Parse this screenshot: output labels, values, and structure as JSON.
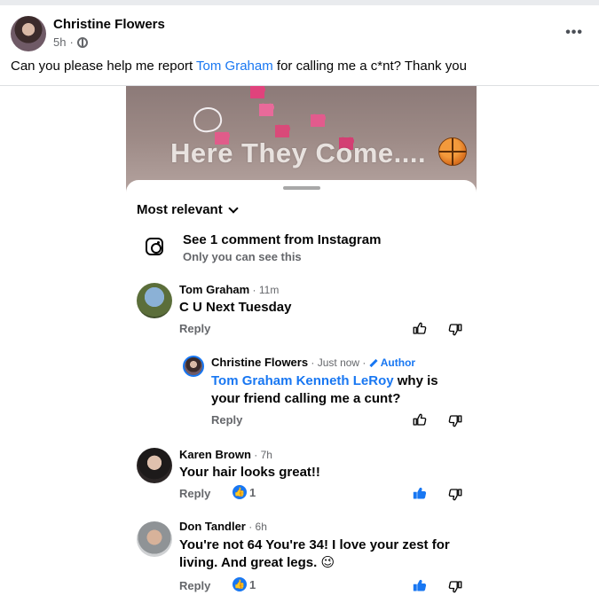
{
  "post": {
    "author": "Christine Flowers",
    "time": "5h",
    "privacy_icon": "globe-icon",
    "text_before": "Can you please help me report ",
    "mention": "Tom Graham",
    "text_after": " for calling me a c*nt? Thank you",
    "more_label": "•••"
  },
  "screenshot": {
    "video_title": "Here They Come....",
    "sort_label": "Most relevant",
    "instagram": {
      "title": "See 1 comment from Instagram",
      "subtitle": "Only you can see this"
    },
    "comments": [
      {
        "name": "Tom Graham",
        "time": " · 11m",
        "text": "C U Next Tuesday",
        "reply_label": "Reply"
      },
      {
        "name": "Christine Flowers",
        "time": " · Just now · ",
        "author_badge": "Author",
        "mention": "Tom Graham Kenneth LeRoy",
        "text_line1_rest": " why is",
        "text_line2": "your friend calling me a cunt?",
        "reply_label": "Reply"
      },
      {
        "name": "Karen Brown",
        "time": " · 7h",
        "text": "Your hair looks great!!",
        "reply_label": "Reply",
        "reaction_count": "1"
      },
      {
        "name": "Don Tandler",
        "time": " · 6h",
        "text_line1": "You're not 64  You're 34! I love your zest for",
        "text_line2": "living. And great legs. 😉",
        "reply_label": "Reply",
        "reaction_count": "1"
      }
    ]
  },
  "colors": {
    "accent": "#1877f2",
    "secondary_text": "#65676b",
    "primary_text": "#050505"
  }
}
